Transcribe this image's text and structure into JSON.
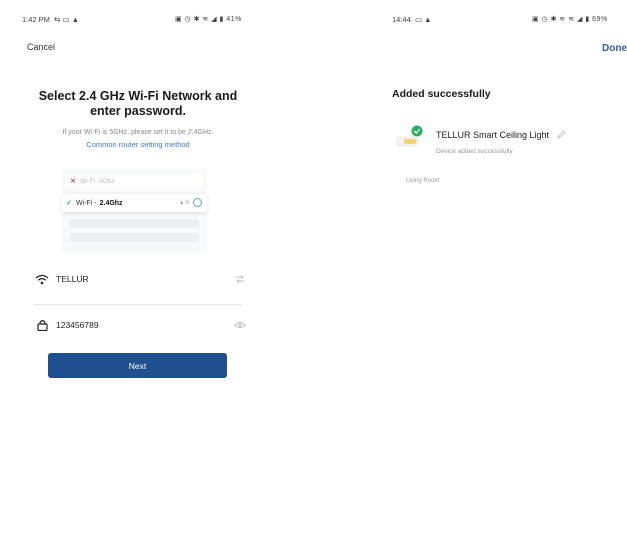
{
  "left": {
    "status": {
      "time": "1:42 PM",
      "icons_text": "41%"
    },
    "cancel_label": "Cancel",
    "title": "Select 2.4 GHz Wi-Fi Network and enter password.",
    "hint": "If your Wi-Fi is 5GHz, please set it to be 2.4GHz.",
    "router_link": "Common router setting method",
    "illustration": {
      "bad_prefix": "Wi-Fi - ",
      "bad_ssid": "5Ghz",
      "good_prefix": "Wi-Fi - ",
      "good_ssid": "2.4Ghz"
    },
    "wifi_value": "TELLUR",
    "password_value": "123456789",
    "next_label": "Next"
  },
  "right": {
    "status": {
      "time": "14:44",
      "icons_text": "69%"
    },
    "done_label": "Done",
    "added_title": "Added successfully",
    "device_name": "TELLUR Smart Ceiling Light",
    "device_status": "Device added successfully",
    "room": "Living Room"
  },
  "colors": {
    "accent": "#1f4f8e",
    "link": "#3a7bd5",
    "success": "#2ab05a",
    "error": "#e14545"
  }
}
